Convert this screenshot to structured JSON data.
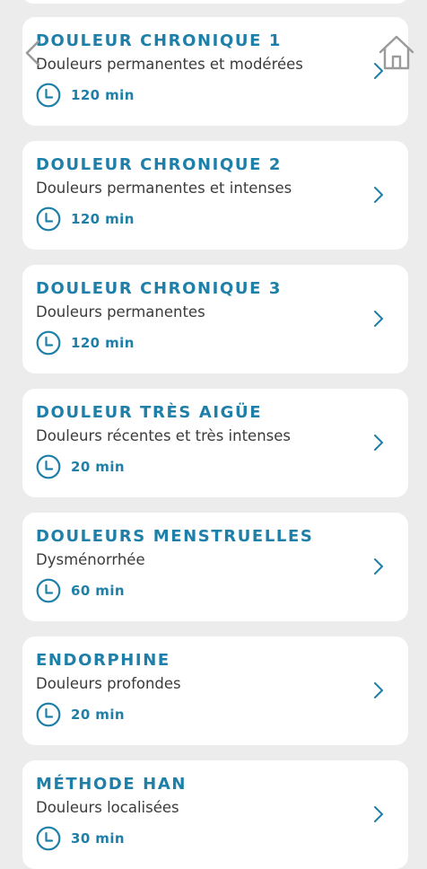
{
  "colors": {
    "accent": "#1e7fa8",
    "background": "#ececec",
    "card": "#ffffff",
    "text": "#3b3b3b"
  },
  "nav": {
    "back_icon": "chevron-left-icon",
    "home_icon": "home-icon"
  },
  "programs": [
    {
      "title": "DOULEUR CHRONIQUE 1",
      "subtitle": "Douleurs permanentes et modérées",
      "duration": "120 min"
    },
    {
      "title": "DOULEUR CHRONIQUE 2",
      "subtitle": "Douleurs permanentes et intenses",
      "duration": "120 min"
    },
    {
      "title": "DOULEUR CHRONIQUE 3",
      "subtitle": "Douleurs permanentes",
      "duration": "120 min"
    },
    {
      "title": "DOULEUR TRÈS AIGÜE",
      "subtitle": "Douleurs récentes et très intenses",
      "duration": "20 min"
    },
    {
      "title": "DOULEURS MENSTRUELLES",
      "subtitle": "Dysménorrhée",
      "duration": "60 min"
    },
    {
      "title": "ENDORPHINE",
      "subtitle": "Douleurs profondes",
      "duration": "20 min"
    },
    {
      "title": "MÉTHODE HAN",
      "subtitle": "Douleurs localisées",
      "duration": "30 min"
    }
  ]
}
